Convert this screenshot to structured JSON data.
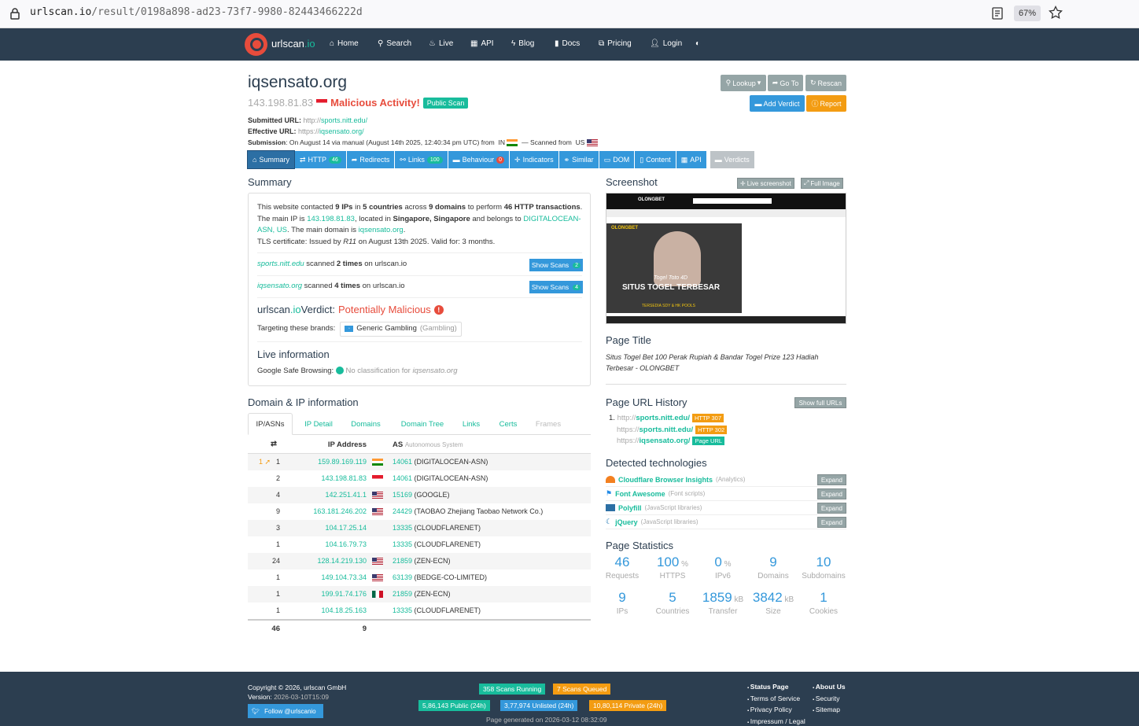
{
  "browser": {
    "url_host": "urlscan.io",
    "url_path": "/result/0198a898-ad23-73f7-9980-82443466222d",
    "zoom": "67%"
  },
  "nav": {
    "brand": "urlscan",
    "brand_tld": ".io",
    "items": [
      "Home",
      "Search",
      "Live",
      "API",
      "Blog",
      "Docs",
      "Pricing",
      "Login"
    ]
  },
  "header": {
    "domain": "iqsensato.org",
    "ip": "143.198.81.83",
    "status": "Malicious Activity!",
    "visibility": "Public Scan",
    "submitted_label": "Submitted URL:",
    "submitted_proto": "http://",
    "submitted_host": "sports.nitt.edu/",
    "effective_label": "Effective URL:",
    "effective_proto": "https://",
    "effective_host": "iqsensato.org/",
    "submission_label": "Submission",
    "submission_text": ": On August 14 via manual (August 14th 2025, 12:40:34 pm UTC) from",
    "from_country": "IN",
    "scanned_from_label": "— Scanned from",
    "scanned_country": "US"
  },
  "actions": {
    "lookup": "Lookup",
    "goto": "Go To",
    "rescan": "Rescan",
    "add_verdict": "Add Verdict",
    "report": "Report"
  },
  "tabs": [
    {
      "label": "Summary",
      "count": ""
    },
    {
      "label": "HTTP",
      "count": "46"
    },
    {
      "label": "Redirects",
      "count": ""
    },
    {
      "label": "Links",
      "count": "100"
    },
    {
      "label": "Behaviour",
      "count": "0"
    },
    {
      "label": "Indicators",
      "count": ""
    },
    {
      "label": "Similar",
      "count": ""
    },
    {
      "label": "DOM",
      "count": ""
    },
    {
      "label": "Content",
      "count": ""
    },
    {
      "label": "API",
      "count": ""
    },
    {
      "label": "Verdicts",
      "count": ""
    }
  ],
  "summary": {
    "title": "Summary",
    "l1_a": "This website contacted ",
    "l1_ips": "9 IPs",
    "l1_b": " in ",
    "l1_countries": "5 countries",
    "l1_c": " across ",
    "l1_domains": "9 domains",
    "l1_d": " to perform ",
    "l1_tx": "46 HTTP transactions",
    "l1_e": ".",
    "l2_a": "The main IP is ",
    "l2_ip": "143.198.81.83",
    "l2_b": ", located in ",
    "l2_loc": "Singapore, Singapore",
    "l2_c": " and belongs to ",
    "l2_asn_1": "DIGITALOCEAN-",
    "l3_asn_2": "ASN, US",
    "l3_a": ". The main domain is ",
    "l3_domain": "iqsensato.org",
    "l3_b": ".",
    "l4_a": "TLS certificate: Issued by ",
    "l4_issuer": "R11",
    "l4_b": " on August 13th 2025. Valid for: 3 months.",
    "scan1_host": "sports.nitt.edu",
    "scan1_a": " scanned ",
    "scan1_times": "2 times",
    "scan1_b": " on urlscan.io",
    "scan1_btn": "Show Scans",
    "scan1_cnt": "2",
    "scan2_host": "iqsensato.org",
    "scan2_a": " scanned ",
    "scan2_times": "4 times",
    "scan2_b": " on urlscan.io",
    "scan2_btn": "Show Scans",
    "scan2_cnt": "4",
    "verdict_brand": "urlscan",
    "verdict_tld": ".io",
    "verdict_label": " Verdict: ",
    "verdict_value": "Potentially Malicious",
    "targeting_label": "Targeting these brands:",
    "brand_name": "Generic Gambling",
    "brand_cat": "(Gambling)",
    "live_title": "Live information",
    "gsb_label": "Google Safe Browsing:",
    "gsb_text": "No classification for ",
    "gsb_domain": "iqsensato.org"
  },
  "domain_ip": {
    "title": "Domain & IP information",
    "tabs": [
      "IP/ASNs",
      "IP Detail",
      "Domains",
      "Domain Tree",
      "Links",
      "Certs",
      "Frames"
    ],
    "head_ip": "IP Address",
    "head_as": "AS",
    "head_as_sub": "Autonomous System",
    "first_redirect": "1",
    "rows": [
      {
        "count": "1",
        "ip": "159.89.169.119",
        "flag": "in",
        "asn": "14061",
        "org": "(DIGITALOCEAN-ASN)"
      },
      {
        "count": "2",
        "ip": "143.198.81.83",
        "flag": "sg",
        "asn": "14061",
        "org": "(DIGITALOCEAN-ASN)"
      },
      {
        "count": "4",
        "ip": "142.251.41.1",
        "flag": "us",
        "asn": "15169",
        "org": "(GOOGLE)"
      },
      {
        "count": "9",
        "ip": "163.181.246.202",
        "flag": "us",
        "asn": "24429",
        "org": "(TAOBAO Zhejiang Taobao Network Co.)"
      },
      {
        "count": "3",
        "ip": "104.17.25.14",
        "flag": "",
        "asn": "13335",
        "org": "(CLOUDFLARENET)"
      },
      {
        "count": "1",
        "ip": "104.16.79.73",
        "flag": "",
        "asn": "13335",
        "org": "(CLOUDFLARENET)"
      },
      {
        "count": "24",
        "ip": "128.14.219.130",
        "flag": "us",
        "asn": "21859",
        "org": "(ZEN-ECN)"
      },
      {
        "count": "1",
        "ip": "149.104.73.34",
        "flag": "us",
        "asn": "63139",
        "org": "(BEDGE-CO-LIMITED)"
      },
      {
        "count": "1",
        "ip": "199.91.74.176",
        "flag": "mx",
        "asn": "21859",
        "org": "(ZEN-ECN)"
      },
      {
        "count": "1",
        "ip": "104.18.25.163",
        "flag": "",
        "asn": "13335",
        "org": "(CLOUDFLARENET)"
      }
    ],
    "foot_count": "46",
    "foot_ips": "9"
  },
  "screenshot": {
    "title": "Screenshot",
    "live_btn": "Live screenshot",
    "full_btn": "Full Image",
    "site_logo": "OLONGBET",
    "banner_text": "SITUS TOGEL TERBESAR",
    "banner_sub": "Togel Toto 4D",
    "banner_foot": "TERSEDIA SDY & HK POOLS"
  },
  "page_title": {
    "title": "Page Title",
    "text": "Situs Togel Bet 100 Perak Rupiah & Bandar Togel Prize 123 Hadiah Terbesar - OLONGBET"
  },
  "url_history": {
    "title": "Page URL History",
    "btn": "Show full URLs",
    "items": [
      {
        "num": "1.",
        "proto": "http://",
        "host": "sports.nitt.edu/",
        "tag": "HTTP 307"
      },
      {
        "num": "",
        "proto": "https://",
        "host": "sports.nitt.edu/",
        "tag": "HTTP 302"
      },
      {
        "num": "",
        "proto": "https://",
        "host": "iqsensato.org/",
        "tag": "Page URL"
      }
    ]
  },
  "tech": {
    "title": "Detected technologies",
    "items": [
      {
        "name": "Cloudflare Browser Insights",
        "cat": "(Analytics)",
        "btn": "Expand"
      },
      {
        "name": "Font Awesome",
        "cat": "(Font scripts)",
        "btn": "Expand"
      },
      {
        "name": "Polyfill",
        "cat": "(JavaScript libraries)",
        "btn": "Expand"
      },
      {
        "name": "jQuery",
        "cat": "(JavaScript libraries)",
        "btn": "Expand"
      }
    ]
  },
  "stats": {
    "title": "Page Statistics",
    "items": [
      {
        "value": "46",
        "unit": "",
        "label": "Requests"
      },
      {
        "value": "100",
        "unit": "%",
        "label": "HTTPS"
      },
      {
        "value": "0",
        "unit": "%",
        "label": "IPv6"
      },
      {
        "value": "9",
        "unit": "",
        "label": "Domains"
      },
      {
        "value": "10",
        "unit": "",
        "label": "Subdomains"
      },
      {
        "value": "9",
        "unit": "",
        "label": "IPs"
      },
      {
        "value": "5",
        "unit": "",
        "label": "Countries"
      },
      {
        "value": "1859",
        "unit": "kB",
        "label": "Transfer"
      },
      {
        "value": "3842",
        "unit": "kB",
        "label": "Size"
      },
      {
        "value": "1",
        "unit": "",
        "label": "Cookies"
      }
    ]
  },
  "footer": {
    "copyright": "Copyright © 2026, urlscan GmbH",
    "version_label": "Version: ",
    "version": "2026-03-10T15:09",
    "twitter": "Follow @urlscanio",
    "running": "358 Scans Running",
    "queued": "7 Scans Queued",
    "public": "5,86,143 Public (24h)",
    "unlisted": "3,77,974 Unlisted (24h)",
    "private": "10,80,114 Private (24h)",
    "generated": "Page generated on 2026-03-12 08:32:09",
    "links_a": [
      "Status Page",
      "Terms of Service",
      "Privacy Policy",
      "Impressum / Legal"
    ],
    "links_b": [
      "About Us",
      "Security",
      "Sitemap"
    ]
  },
  "colors": {
    "navbar": "#2c3e50",
    "accent": "#18bc9c",
    "primary": "#3498db",
    "danger": "#e74c3c",
    "warning": "#f39c12"
  }
}
